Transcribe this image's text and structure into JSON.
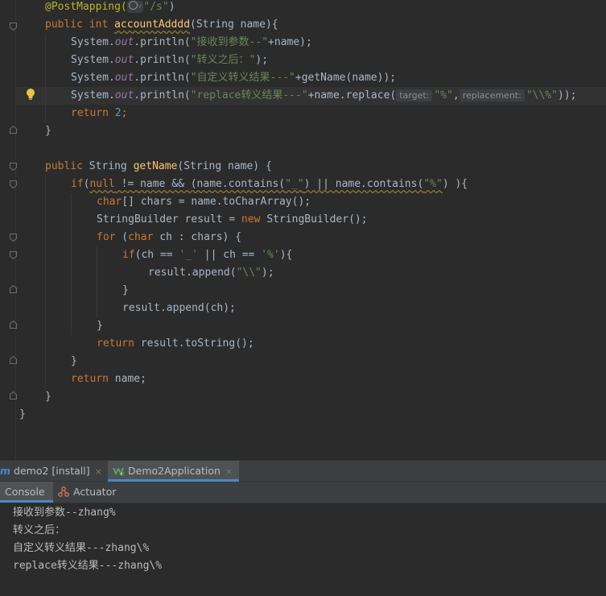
{
  "editor": {
    "lines": {
      "l1": {
        "annotation": "@PostMapping(",
        "path": "\"/s\"",
        "close": ")"
      },
      "l2": {
        "kw1": "public",
        "kw2": "int",
        "method": "accountAdddd",
        "params": "(String name){"
      },
      "l3": {
        "obj": "System.",
        "out": "out",
        "call": ".println(",
        "str": "\"接收到参数--\"",
        "rest": "+name);"
      },
      "l4": {
        "obj": "System.",
        "out": "out",
        "call": ".println(",
        "str": "\"转义之后：\"",
        "rest": ");"
      },
      "l5": {
        "obj": "System.",
        "out": "out",
        "call": ".println(",
        "str": "\"自定义转义结果---\"",
        "rest": "+getName(name));"
      },
      "l6": {
        "obj": "System.",
        "out": "out",
        "call": ".println(",
        "str": "\"replace转义结果---\"",
        "mid": "+name.replace(",
        "hint_target": "target:",
        "arg1": "\"%\"",
        "comma": ",",
        "hint_replacement": "replacement:",
        "arg2": "\"\\\\%\"",
        "rest": "));"
      },
      "l7": {
        "kw": "return",
        "num": "2",
        "semi": ";"
      },
      "l8": {
        "text": "}"
      },
      "l10": {
        "kw1": "public",
        "type": "String",
        "method": "getName",
        "params": "(String name) {"
      },
      "l11": {
        "kw": "if",
        "open": "(",
        "null": "null",
        "mid": " != name && (name.contains(",
        "s1": "\"_\"",
        "mid2": ") || name.contains(",
        "s2": "\"%\"",
        "rest": ") ){"
      },
      "l12": {
        "kw": "char",
        "rest": "[] chars = name.toCharArray();"
      },
      "l13": {
        "a": "StringBuilder result = ",
        "kw": "new",
        "b": " StringBuilder();"
      },
      "l14": {
        "kw": "for",
        "a": " (",
        "kw2": "char",
        "b": " ch : chars) {"
      },
      "l15": {
        "kw": "if",
        "a": "(ch == ",
        "s1": "'_'",
        "b": " || ch == ",
        "s2": "'%'",
        "c": "){"
      },
      "l16": {
        "a": "result.append(",
        "str": "\"\\\\\"",
        "rest": ");"
      },
      "l17": {
        "text": "}"
      },
      "l18": {
        "text": "result.append(ch);"
      },
      "l19": {
        "text": "}"
      },
      "l20": {
        "kw": "return",
        "rest": " result.toString();"
      },
      "l21": {
        "text": "}"
      },
      "l22": {
        "kw": "return",
        "rest": " name;"
      },
      "l23": {
        "text": "}"
      },
      "l24": {
        "text": "}"
      }
    }
  },
  "run_tabs": {
    "tab1": {
      "prefix": "m",
      "label": "demo2 [install]",
      "close": "×"
    },
    "tab2": {
      "label": "Demo2Application",
      "close": "×"
    }
  },
  "sub_tabs": {
    "console": "Console",
    "actuator": "Actuator"
  },
  "console": {
    "lines": [
      "接收到参数--zhang%",
      "转义之后：",
      "自定义转义结果---zhang\\%",
      "replace转义结果---zhang\\%"
    ]
  },
  "colors": {
    "editor_bg": "#2b2b2b",
    "keyword": "#cc7832",
    "string": "#6a8759",
    "annotation": "#bbb529",
    "method": "#ffc66d",
    "static_field": "#9876aa",
    "number": "#6897bb",
    "accent": "#4a88c7"
  },
  "icons": {
    "gutter": "fold-marker-icon",
    "intention": "lightbulb-icon",
    "mapping": "globe-icon",
    "run_config": "spring-boot-icon",
    "actuator": "actuator-icon"
  }
}
